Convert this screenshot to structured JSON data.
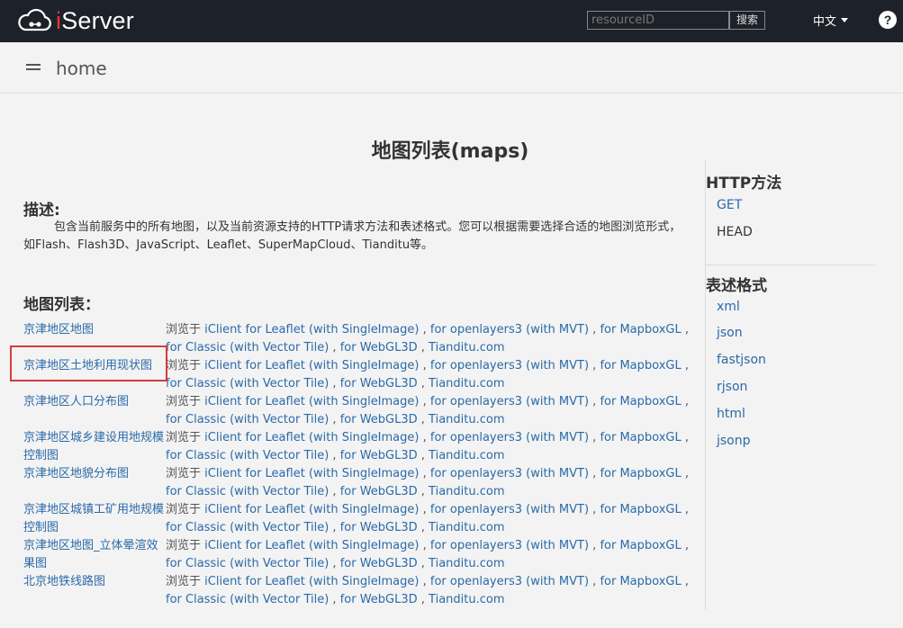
{
  "nav": {
    "logo_text_i": "i",
    "logo_text_rest": "Server",
    "search_placeholder": "resourceID",
    "search_button": "搜索",
    "language": "中文",
    "help": "?"
  },
  "breadcrumb": {
    "label": "home"
  },
  "main": {
    "title": "地图列表(maps)",
    "desc_heading": "描述:",
    "desc_text": "包含当前服务中的所有地图，以及当前资源支持的HTTP请求方法和表述格式。您可以根据需要选择合适的地图浏览形式，如Flash、Flash3D、JavaScript、Leaflet、SuperMapCloud、Tianditu等。",
    "list_heading": "地图列表：",
    "browse_prefix": "浏览于",
    "links": [
      "iClient for Leaflet (with SingleImage)",
      "for openlayers3 (with MVT)",
      "for MapboxGL",
      "for Classic (with Vector Tile)",
      "for WebGL3D",
      "Tianditu.com"
    ],
    "maps": [
      {
        "name": "京津地区地图"
      },
      {
        "name": "京津地区土地利用现状图"
      },
      {
        "name": "京津地区人口分布图"
      },
      {
        "name": "京津地区城乡建设用地规模控制图"
      },
      {
        "name": "京津地区地貌分布图"
      },
      {
        "name": "京津地区城镇工矿用地规模控制图"
      },
      {
        "name": "京津地区地图_立体晕渲效果图"
      },
      {
        "name": "北京地铁线路图"
      }
    ]
  },
  "sidebar": {
    "http_heading": "HTTP方法",
    "methods": [
      "GET",
      "HEAD"
    ],
    "format_heading": "表述格式",
    "formats": [
      "xml",
      "json",
      "fastjson",
      "rjson",
      "html",
      "jsonp"
    ]
  },
  "colors": {
    "nav_bg": "#1d2129",
    "link": "#2a6aa8",
    "highlight": "#d9393b",
    "logo_accent": "#e8382f"
  }
}
